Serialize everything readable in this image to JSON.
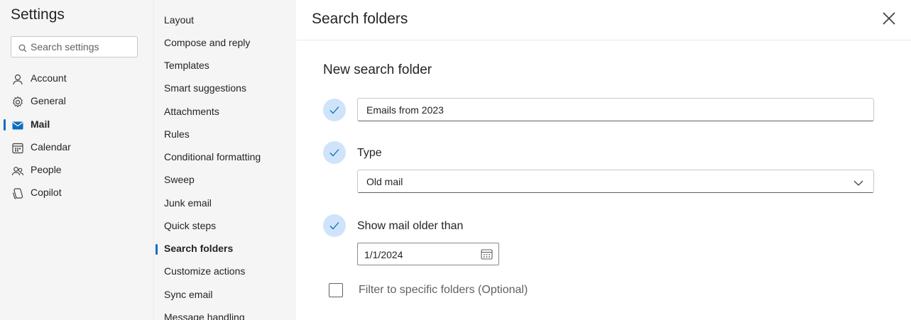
{
  "settings": {
    "title": "Settings",
    "search_placeholder": "Search settings",
    "categories": [
      {
        "label": "Account",
        "icon": "person-icon"
      },
      {
        "label": "General",
        "icon": "gear-icon"
      },
      {
        "label": "Mail",
        "icon": "mail-icon",
        "active": true
      },
      {
        "label": "Calendar",
        "icon": "calendar-icon"
      },
      {
        "label": "People",
        "icon": "people-icon"
      },
      {
        "label": "Copilot",
        "icon": "copilot-icon"
      }
    ]
  },
  "mail_nav": {
    "items": [
      {
        "label": "Layout"
      },
      {
        "label": "Compose and reply"
      },
      {
        "label": "Templates"
      },
      {
        "label": "Smart suggestions"
      },
      {
        "label": "Attachments"
      },
      {
        "label": "Rules"
      },
      {
        "label": "Conditional formatting"
      },
      {
        "label": "Sweep"
      },
      {
        "label": "Junk email"
      },
      {
        "label": "Quick steps"
      },
      {
        "label": "Search folders",
        "active": true
      },
      {
        "label": "Customize actions"
      },
      {
        "label": "Sync email"
      },
      {
        "label": "Message handling"
      }
    ]
  },
  "panel": {
    "title": "Search folders",
    "section_title": "New search folder",
    "name_value": "Emails from 2023",
    "type_label": "Type",
    "type_value": "Old mail",
    "older_label": "Show mail older than",
    "date_value": "1/1/2024",
    "filter_label": "Filter to specific folders (Optional)"
  },
  "colors": {
    "accent": "#0f6cbd",
    "check_bg": "#cfe4fa",
    "nav_bg": "#f5f5f5"
  }
}
